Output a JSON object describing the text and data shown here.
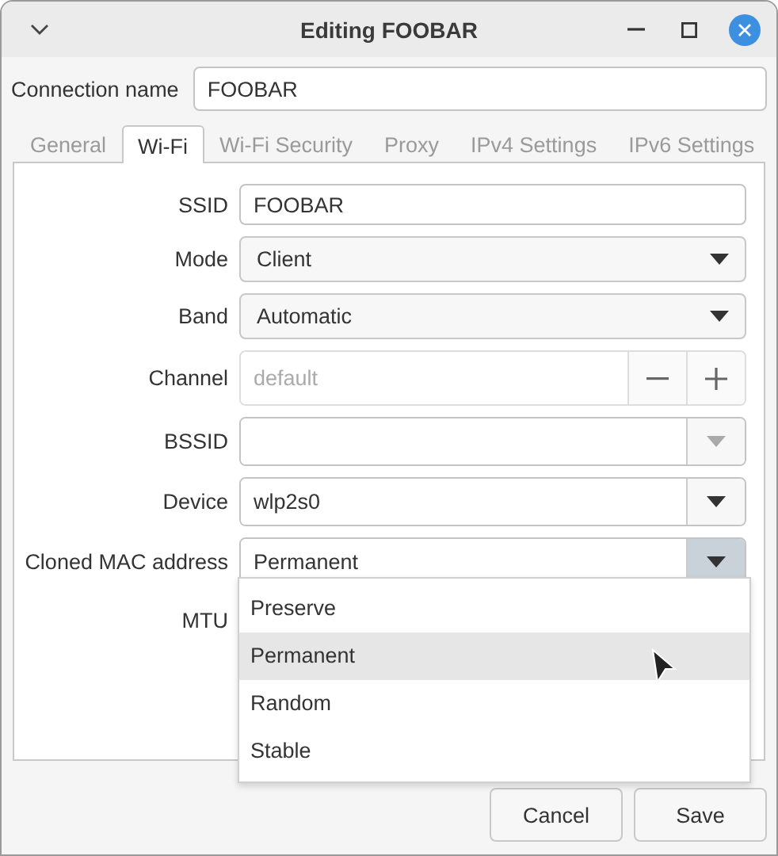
{
  "window": {
    "title": "Editing FOOBAR"
  },
  "connection_name": {
    "label": "Connection name",
    "value": "FOOBAR"
  },
  "tabs": [
    {
      "label": "General",
      "selected": false
    },
    {
      "label": "Wi-Fi",
      "selected": true
    },
    {
      "label": "Wi-Fi Security",
      "selected": false
    },
    {
      "label": "Proxy",
      "selected": false
    },
    {
      "label": "IPv4 Settings",
      "selected": false
    },
    {
      "label": "IPv6 Settings",
      "selected": false
    }
  ],
  "fields": [
    {
      "label": "SSID",
      "kind": "entry",
      "value": "FOOBAR"
    },
    {
      "label": "Mode",
      "kind": "combo",
      "value": "Client"
    },
    {
      "label": "Band",
      "kind": "combo",
      "value": "Automatic"
    },
    {
      "label": "Channel",
      "kind": "spin",
      "placeholder": "default"
    },
    {
      "label": "BSSID",
      "kind": "combo_entry",
      "disabled": true
    },
    {
      "label": "Device",
      "kind": "combo_entry",
      "value": "wlp2s0",
      "disabled": false
    },
    {
      "label": "Cloned MAC address",
      "kind": "combo_entry",
      "value": "Permanent",
      "disabled": false,
      "expanded": true
    },
    {
      "label": "MTU",
      "kind": "hidden"
    }
  ],
  "dropdown": {
    "options": [
      {
        "label": "Preserve",
        "selected": false
      },
      {
        "label": "Permanent",
        "selected": true
      },
      {
        "label": "Random",
        "selected": false
      },
      {
        "label": "Stable",
        "selected": false
      }
    ]
  },
  "buttons": [
    "Cancel",
    "Save"
  ]
}
